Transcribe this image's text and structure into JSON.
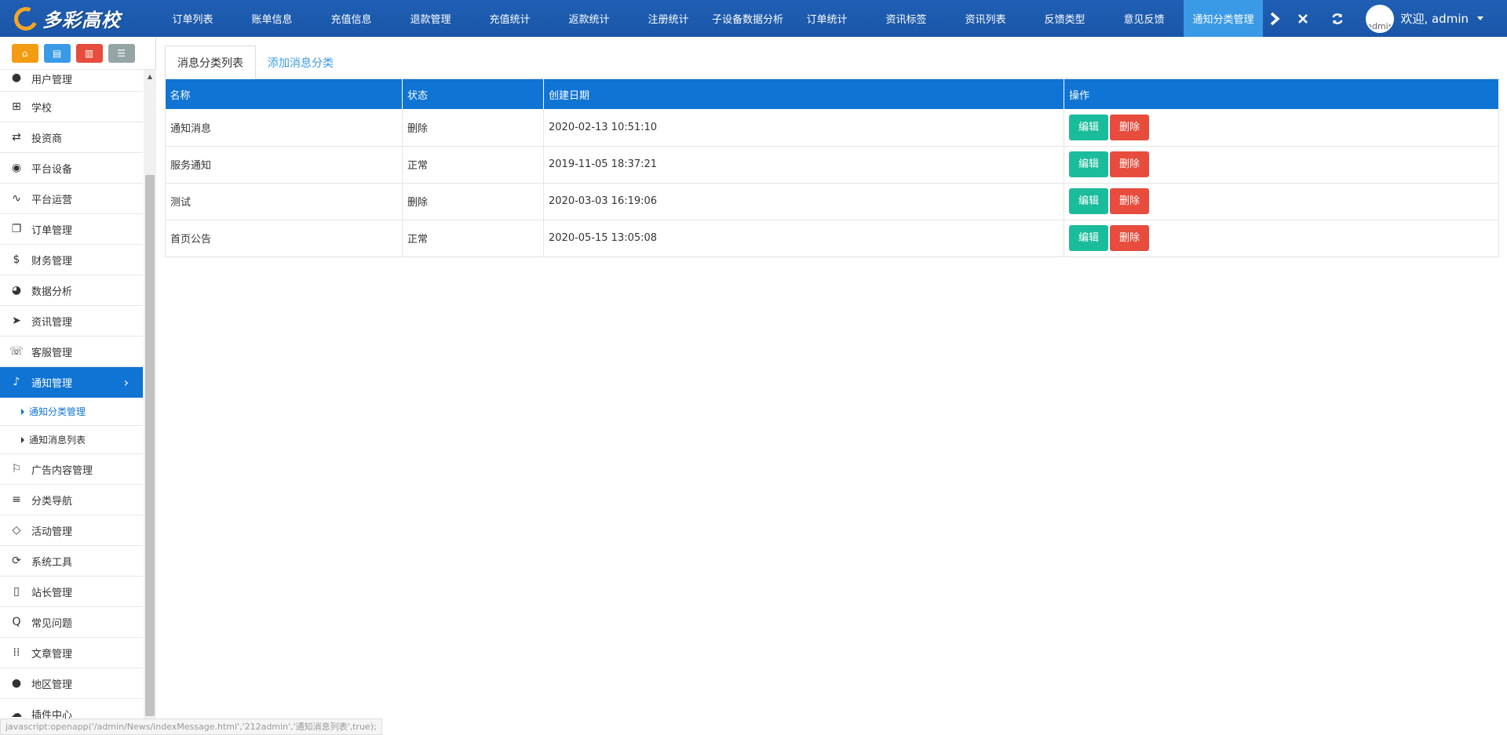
{
  "brand": {
    "logo_text": "多彩高校"
  },
  "topnav": {
    "items": [
      "订单列表",
      "账单信息",
      "充值信息",
      "退款管理",
      "充值统计",
      "返款统计",
      "注册统计",
      "子设备数据分析",
      "订单统计",
      "资讯标签",
      "资讯列表",
      "反馈类型",
      "意见反馈",
      "通知分类管理"
    ],
    "active_index": 13,
    "next_icon": "chevron-right-icon"
  },
  "tools": {
    "close_icon": "close-icon",
    "refresh_icon": "refresh-icon"
  },
  "user": {
    "avatar_alt": "admin",
    "greeting": "欢迎, admin"
  },
  "quick_buttons": [
    {
      "icon": "home-icon",
      "color": "#f39c12"
    },
    {
      "icon": "document-icon",
      "color": "#3a9ae6"
    },
    {
      "icon": "trash-icon",
      "color": "#e74c3c"
    },
    {
      "icon": "list-icon",
      "color": "#95a5a6"
    }
  ],
  "sidebar": {
    "items": [
      {
        "label": "用户管理",
        "icon": "user-icon"
      },
      {
        "label": "学校",
        "icon": "sitemap-icon"
      },
      {
        "label": "投资商",
        "icon": "handshake-icon"
      },
      {
        "label": "平台设备",
        "icon": "podcast-icon"
      },
      {
        "label": "平台运营",
        "icon": "line-chart-icon"
      },
      {
        "label": "订单管理",
        "icon": "clone-icon"
      },
      {
        "label": "财务管理",
        "icon": "dollar-icon"
      },
      {
        "label": "数据分析",
        "icon": "pie-chart-icon"
      },
      {
        "label": "资讯管理",
        "icon": "telegram-icon"
      },
      {
        "label": "客服管理",
        "icon": "volume-control-phone-icon"
      },
      {
        "label": "通知管理",
        "icon": "bell-icon",
        "active": true
      },
      {
        "label": "广告内容管理",
        "icon": "flag-icon"
      },
      {
        "label": "分类导航",
        "icon": "bars-icon"
      },
      {
        "label": "活动管理",
        "icon": "diamond-icon"
      },
      {
        "label": "系统工具",
        "icon": "refresh-icon"
      },
      {
        "label": "站长管理",
        "icon": "id-badge-icon"
      },
      {
        "label": "常见问题",
        "icon": "question-icon"
      },
      {
        "label": "文章管理",
        "icon": "th-icon"
      },
      {
        "label": "地区管理",
        "icon": "map-marker-icon"
      },
      {
        "label": "插件中心",
        "icon": "cloud-icon"
      }
    ],
    "sub_items": [
      {
        "label": "通知分类管理",
        "current": true
      },
      {
        "label": "通知消息列表",
        "current": false
      }
    ]
  },
  "tabs": [
    "消息分类列表",
    "添加消息分类"
  ],
  "table": {
    "headers": [
      "名称",
      "状态",
      "创建日期",
      "操作"
    ],
    "rows": [
      {
        "name": "通知消息",
        "status": "删除",
        "date": "2020-02-13 10:51:10"
      },
      {
        "name": "服务通知",
        "status": "正常",
        "date": "2019-11-05 18:37:21"
      },
      {
        "name": "测试",
        "status": "删除",
        "date": "2020-03-03 16:19:06"
      },
      {
        "name": "首页公告",
        "status": "正常",
        "date": "2020-05-15 13:05:08"
      }
    ],
    "edit_label": "编辑",
    "delete_label": "删除"
  },
  "statusbar": {
    "text": "javascript:openapp('/admin/News/indexMessage.html','212admin','通知消息列表',true);"
  },
  "colors": {
    "topbar": "#1a56a8",
    "accent": "#0f74d4",
    "active_tab": "#3a9ae6",
    "edit": "#1abc9c",
    "delete": "#e74c3c"
  }
}
